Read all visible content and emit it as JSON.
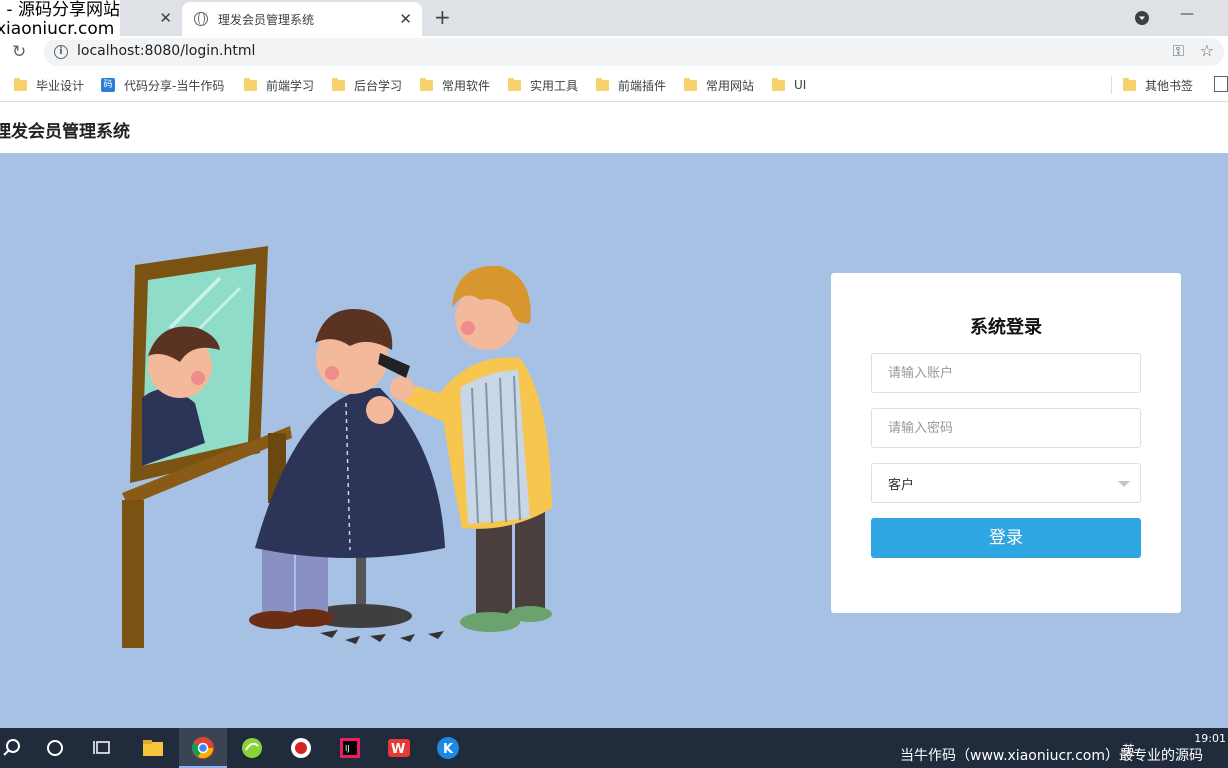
{
  "watermark": {
    "line1": "码 - 源码分享网站",
    "line2": "xiaoniucr.com"
  },
  "browser": {
    "tabs": [
      {
        "title": "",
        "close": "✕"
      },
      {
        "title": "理发会员管理系统",
        "close": "✕"
      }
    ],
    "new_tab": "+",
    "url": "localhost:8080/login.html",
    "minimize": "—"
  },
  "bookmarks": [
    {
      "label": "毕业设计",
      "icon": "folder-icon"
    },
    {
      "label": "代码分享-当牛作码",
      "icon": "site-icon"
    },
    {
      "label": "前端学习",
      "icon": "folder-icon"
    },
    {
      "label": "后台学习",
      "icon": "folder-icon"
    },
    {
      "label": "常用软件",
      "icon": "folder-icon"
    },
    {
      "label": "实用工具",
      "icon": "folder-icon"
    },
    {
      "label": "前端插件",
      "icon": "folder-icon"
    },
    {
      "label": "常用网站",
      "icon": "folder-icon"
    },
    {
      "label": "UI",
      "icon": "folder-icon"
    },
    {
      "label": "其他书签",
      "icon": "folder-icon"
    }
  ],
  "header": {
    "title": "理发会员管理系统"
  },
  "login": {
    "title": "系统登录",
    "account_placeholder": "请输入账户",
    "password_placeholder": "请输入密码",
    "role_value": "客户",
    "submit_label": "登录"
  },
  "taskbar": {
    "tray_text": "当牛作码（www.xiaoniucr.com）最专业的源码",
    "ime": "英",
    "time": "19:01"
  },
  "colors": {
    "page_bg": "#a7c1e4",
    "accent": "#2fa6e1",
    "card_bg": "#ffffff"
  }
}
